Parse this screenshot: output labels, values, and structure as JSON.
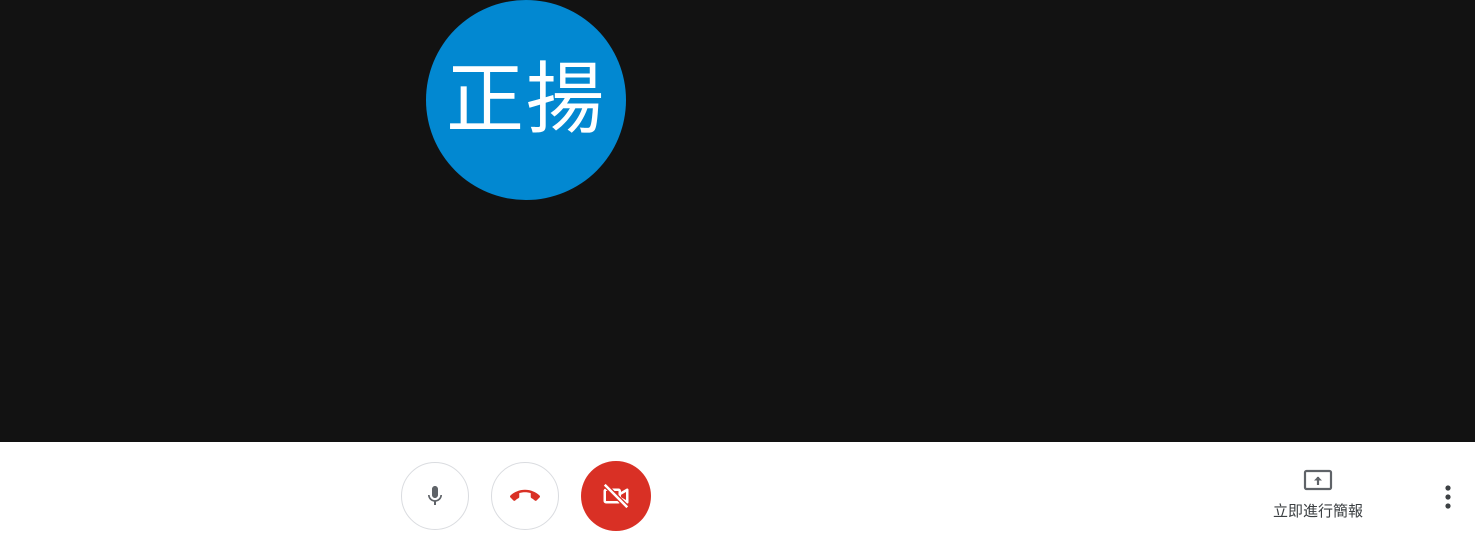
{
  "participant": {
    "avatar_text": "正揚",
    "avatar_color": "#0288d1"
  },
  "controls": {
    "mic_icon": "microphone-icon",
    "hangup_icon": "phone-hangup-icon",
    "hangup_color": "#d93025",
    "camera_icon": "camera-off-icon",
    "camera_state": "off",
    "camera_bg_color": "#d93025"
  },
  "present": {
    "icon": "present-screen-icon",
    "label": "立即進行簡報"
  },
  "more": {
    "icon": "more-vert-icon"
  }
}
